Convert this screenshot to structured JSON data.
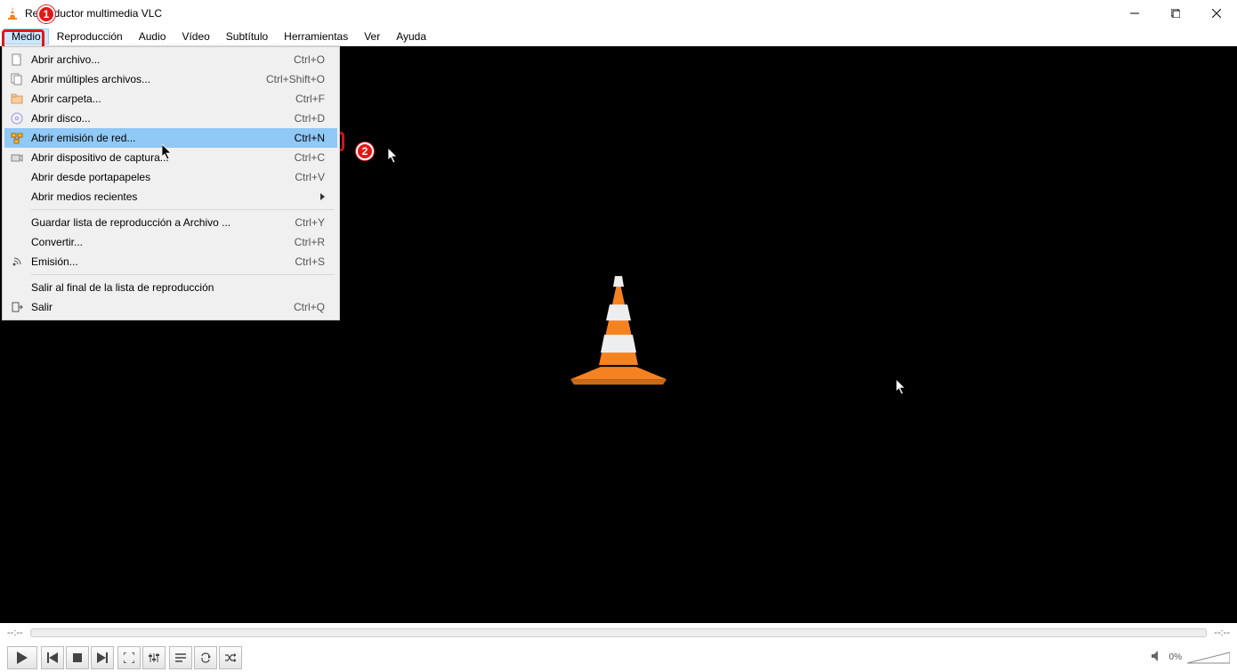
{
  "title": "Reproductor multimedia VLC",
  "menubar": [
    "Medio",
    "Reproducción",
    "Audio",
    "Vídeo",
    "Subtítulo",
    "Herramientas",
    "Ver",
    "Ayuda"
  ],
  "dropdown": {
    "groups": [
      [
        {
          "label": "Abrir archivo...",
          "shortcut": "Ctrl+O",
          "icon": "file"
        },
        {
          "label": "Abrir múltiples archivos...",
          "shortcut": "Ctrl+Shift+O",
          "icon": "files"
        },
        {
          "label": "Abrir carpeta...",
          "shortcut": "Ctrl+F",
          "icon": "folder"
        },
        {
          "label": "Abrir disco...",
          "shortcut": "Ctrl+D",
          "icon": "disc"
        },
        {
          "label": "Abrir emisión de red...",
          "shortcut": "Ctrl+N",
          "icon": "network",
          "highlight": true
        },
        {
          "label": "Abrir dispositivo de captura...",
          "shortcut": "Ctrl+C",
          "icon": "capture"
        },
        {
          "label": "Abrir desde portapapeles",
          "shortcut": "Ctrl+V",
          "icon": ""
        },
        {
          "label": "Abrir medios recientes",
          "shortcut": "",
          "icon": "",
          "submenu": true
        }
      ],
      [
        {
          "label": "Guardar lista de reproducción a Archivo ...",
          "shortcut": "Ctrl+Y",
          "icon": ""
        },
        {
          "label": "Convertir...",
          "shortcut": "Ctrl+R",
          "icon": ""
        },
        {
          "label": "Emisión...",
          "shortcut": "Ctrl+S",
          "icon": "stream"
        }
      ],
      [
        {
          "label": "Salir al final de la lista de reproducción",
          "shortcut": "",
          "icon": ""
        },
        {
          "label": "Salir",
          "shortcut": "Ctrl+Q",
          "icon": "quit"
        }
      ]
    ]
  },
  "callouts": {
    "one": "1",
    "two": "2"
  },
  "time": {
    "left": "--:--",
    "right": "--:--"
  },
  "volume": {
    "percent": "0%"
  }
}
